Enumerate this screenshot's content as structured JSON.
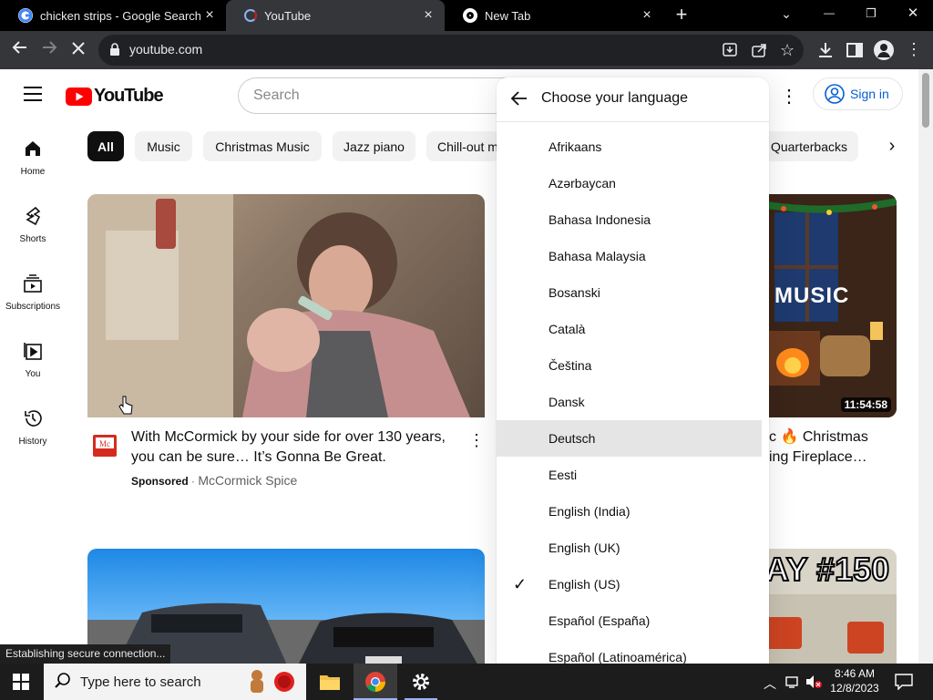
{
  "browser": {
    "tabs": [
      {
        "title": "chicken strips - Google Search",
        "close": "×"
      },
      {
        "title": "YouTube",
        "close": "×"
      },
      {
        "title": "New Tab",
        "close": "×"
      }
    ],
    "new_tab": "+",
    "window_controls": {
      "dropdown": "⌄",
      "minimize": "—",
      "restore": "❐",
      "close": "✕"
    },
    "url": "youtube.com",
    "status": "Establishing secure connection..."
  },
  "youtube": {
    "logo_text": "YouTube",
    "search_placeholder": "Search",
    "sign_in": "Sign in",
    "chips": [
      "All",
      "Music",
      "Christmas Music",
      "Jazz piano",
      "Chill-out m",
      "Quarterbacks"
    ],
    "sidebar": [
      {
        "label": "Home",
        "icon": "home-icon"
      },
      {
        "label": "Shorts",
        "icon": "shorts-icon"
      },
      {
        "label": "Subscriptions",
        "icon": "subscriptions-icon"
      },
      {
        "label": "You",
        "icon": "you-icon"
      },
      {
        "label": "History",
        "icon": "history-icon"
      }
    ],
    "video1": {
      "title_line1": "With McCormick by your side for over 130 years,",
      "title_line2": "you can be sure… It’s Gonna Be Great.",
      "sponsored": "Sponsored",
      "separator": "·",
      "channel": "McCormick Spice"
    },
    "video2": {
      "title_line1": "c 🔥 Christmas",
      "title_line2": "ing Fireplace…",
      "duration": "11:54:58",
      "thumb_text": "MUSIC"
    },
    "video4": {
      "thumb_text": "AY #150"
    }
  },
  "language_menu": {
    "title": "Choose your language",
    "items": [
      {
        "label": "Afrikaans"
      },
      {
        "label": "Azərbaycan"
      },
      {
        "label": "Bahasa Indonesia"
      },
      {
        "label": "Bahasa Malaysia"
      },
      {
        "label": "Bosanski"
      },
      {
        "label": "Català"
      },
      {
        "label": "Čeština"
      },
      {
        "label": "Dansk"
      },
      {
        "label": "Deutsch",
        "hovered": true
      },
      {
        "label": "Eesti"
      },
      {
        "label": "English (India)"
      },
      {
        "label": "English (UK)"
      },
      {
        "label": "English (US)",
        "checked": true
      },
      {
        "label": "Español (España)"
      },
      {
        "label": "Español (Latinoamérica)"
      }
    ],
    "check": "✓"
  },
  "taskbar": {
    "search_placeholder": "Type here to search",
    "time": "8:46 AM",
    "date": "12/8/2023"
  },
  "colors": {
    "youtube_red": "#ff0000",
    "link_blue": "#065fd4",
    "chrome_dark": "#35363a"
  }
}
